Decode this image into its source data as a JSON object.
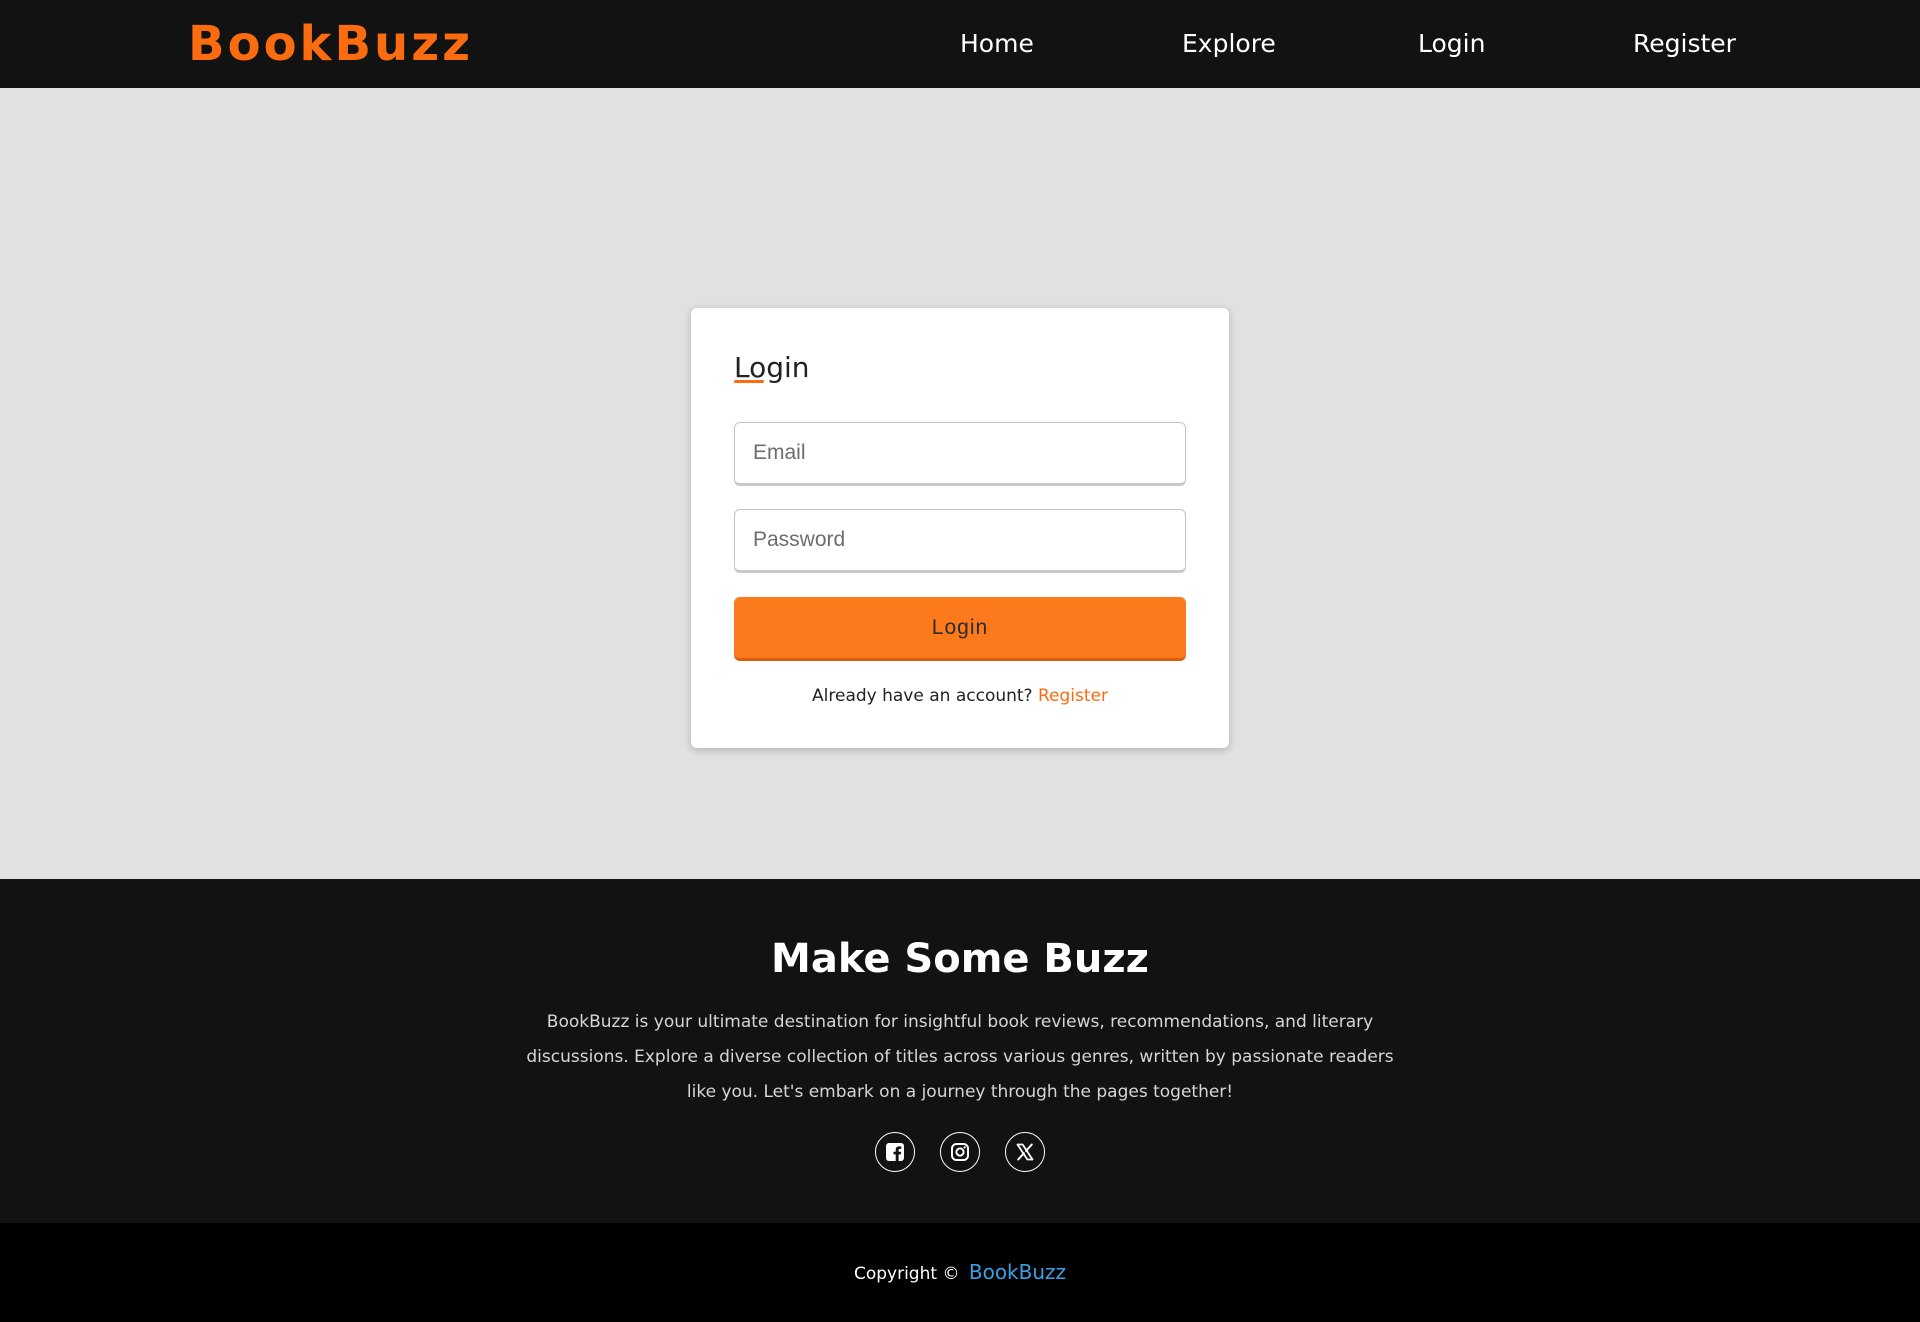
{
  "navbar": {
    "brand": "BookBuzz",
    "links": [
      {
        "label": "Home"
      },
      {
        "label": "Explore"
      },
      {
        "label": "Login"
      },
      {
        "label": "Register"
      }
    ]
  },
  "login_form": {
    "title": "Login",
    "email_placeholder": "Email",
    "email_value": "",
    "password_placeholder": "Password",
    "password_value": "",
    "submit_label": "Login",
    "alt_prompt": "Already have an account?",
    "alt_link": "Register"
  },
  "footer": {
    "title": "Make Some Buzz",
    "description": "BookBuzz is your ultimate destination for insightful book reviews, recommendations, and literary discussions. Explore a diverse collection of titles across various genres, written by passionate readers like you. Let's embark on a journey through the pages together!",
    "socials": [
      {
        "icon": "facebook-icon"
      },
      {
        "icon": "instagram-icon"
      },
      {
        "icon": "x-twitter-icon"
      }
    ],
    "copyright_prefix": "Copyright ©",
    "copyright_link": "BookBuzz"
  },
  "colors": {
    "brand_orange": "#fb6b0f",
    "button_orange": "#fd7a1c",
    "nav_background": "#121212",
    "page_background": "#e1e1e1",
    "copyright_link": "#3aa0e4"
  }
}
